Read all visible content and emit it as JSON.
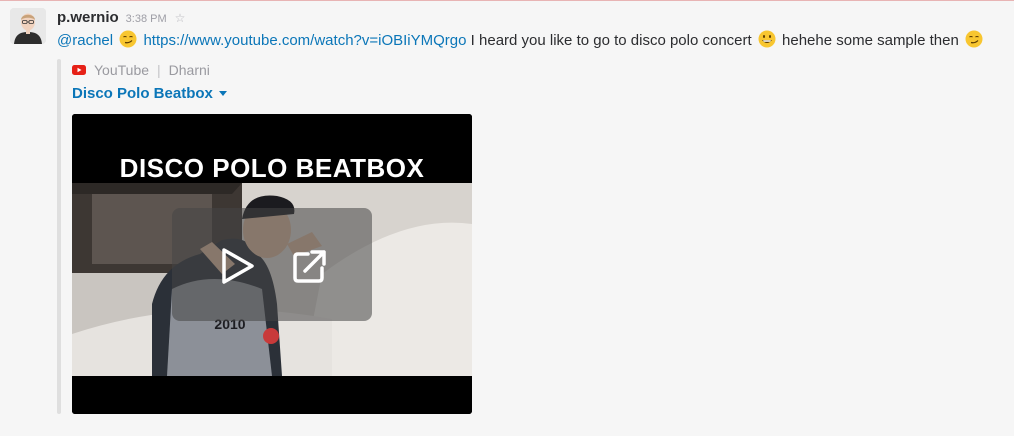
{
  "message": {
    "sender": "p.wernio",
    "time": "3:38 PM",
    "mention": "@rachel",
    "link": "https://www.youtube.com/watch?v=iOBIiYMQrgo",
    "text_1": "I heard you like to go to disco polo concert",
    "text_2": "hehehe some sample then"
  },
  "attachment": {
    "service": "YouTube",
    "author": "Dharni",
    "title": "Disco Polo Beatbox",
    "video_banner": "DISCO POLO BEATBOX",
    "jersey_text": "2010"
  },
  "colors": {
    "link": "#0b76b8",
    "youtube_red": "#e62117",
    "video_bg": "#000000"
  },
  "icons": [
    "avatar",
    "star-icon",
    "smirk-emoji",
    "grin-emoji",
    "youtube-icon",
    "caret-down-icon",
    "play-icon",
    "external-link-icon"
  ]
}
